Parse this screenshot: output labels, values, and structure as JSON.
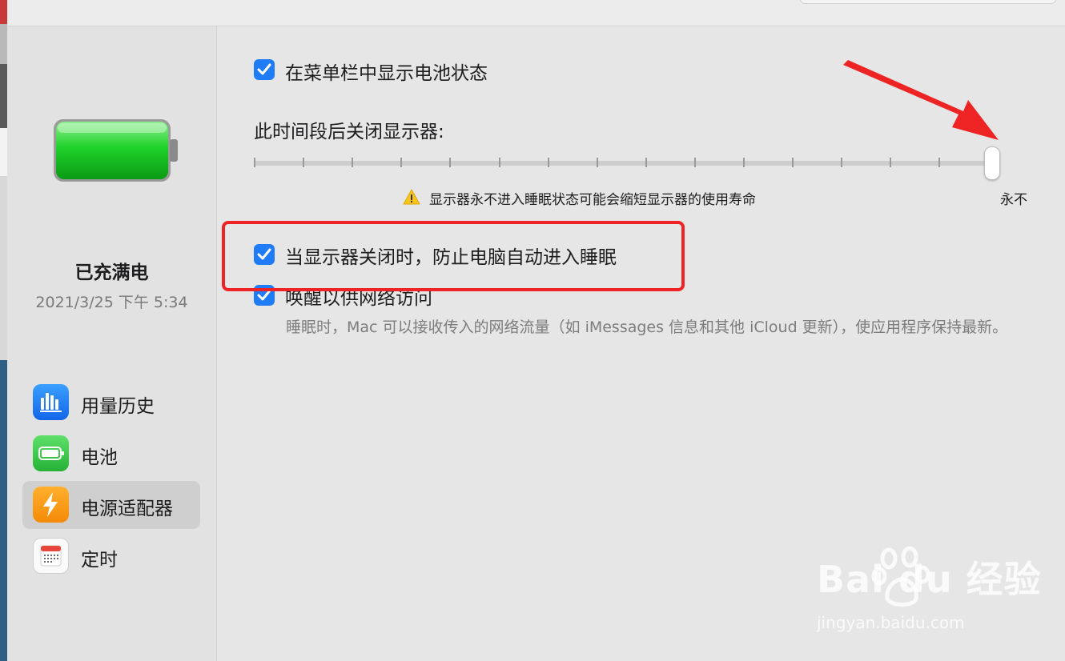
{
  "sidebar": {
    "status_title": "已充满电",
    "status_date": "2021/3/25 下午 5:34",
    "items": [
      {
        "label": "用量历史",
        "icon": "bar-chart-icon"
      },
      {
        "label": "电池",
        "icon": "battery-icon"
      },
      {
        "label": "电源适配器",
        "icon": "lightning-icon",
        "selected": true
      },
      {
        "label": "定时",
        "icon": "calendar-icon"
      }
    ]
  },
  "main": {
    "show_battery_status_label": "在菜单栏中显示电池状态",
    "show_battery_status_checked": true,
    "display_off_label": "此时间段后关闭显示器:",
    "display_off_slider_value": "永不",
    "warning_text": "显示器永不进入睡眠状态可能会缩短显示器的使用寿命",
    "never_label": "永不",
    "prevent_sleep_label": "当显示器关闭时，防止电脑自动进入睡眠",
    "prevent_sleep_checked": true,
    "wake_network_label": "唤醒以供网络访问",
    "wake_network_checked": true,
    "wake_network_desc": "睡眠时，Mac 可以接收传入的网络流量（如 iMessages 信息和其他 iCloud 更新），使应用程序保持最新。"
  },
  "watermark": {
    "logo": "Bai du 经验",
    "url": "jingyan.baidu.com"
  },
  "colors": {
    "accent": "#1f7cf6",
    "highlight": "#ee2424",
    "battery_green": "#1fd12a"
  }
}
